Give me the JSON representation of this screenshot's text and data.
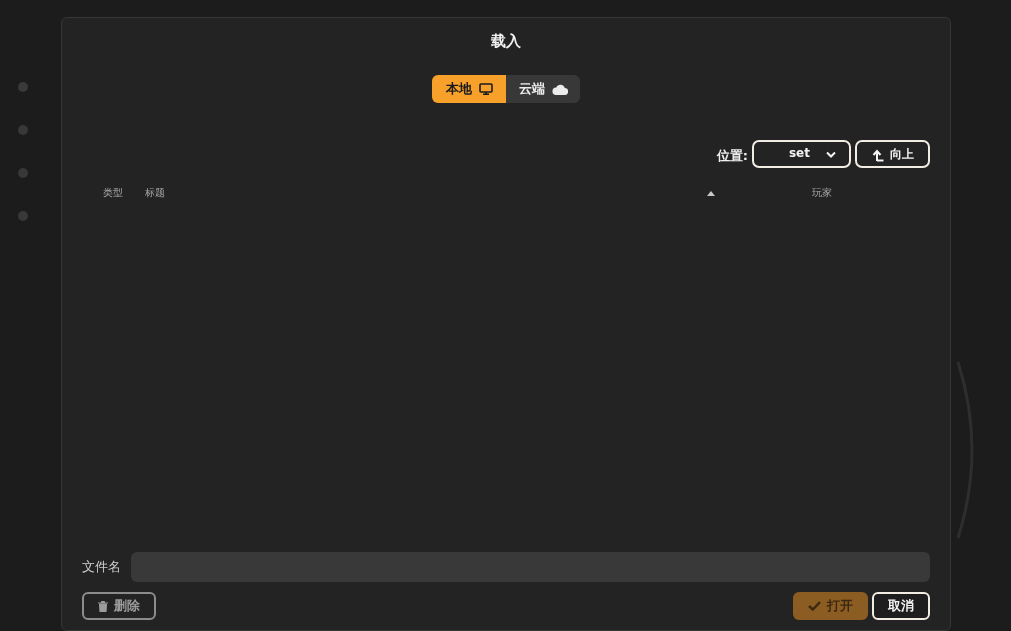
{
  "dialog": {
    "title": "载入"
  },
  "source_tabs": [
    {
      "kind": "local",
      "label": "本地",
      "selected": true
    },
    {
      "kind": "cloud",
      "label": "云端",
      "selected": false
    }
  ],
  "location": {
    "label": "位置:",
    "value": "set",
    "up_button": "向上"
  },
  "table": {
    "columns": [
      {
        "label": "类型",
        "sorted": false
      },
      {
        "label": "标题",
        "sorted": true
      },
      {
        "label": "玩家",
        "sorted": false
      }
    ]
  },
  "filename": {
    "label": "文件名"
  },
  "buttons": [
    {
      "kind": "delete",
      "label": "删除",
      "disabled": true
    },
    {
      "kind": "open",
      "label": "打开",
      "disabled": true
    },
    {
      "kind": "cancel",
      "label": "取消",
      "disabled": false
    }
  ]
}
